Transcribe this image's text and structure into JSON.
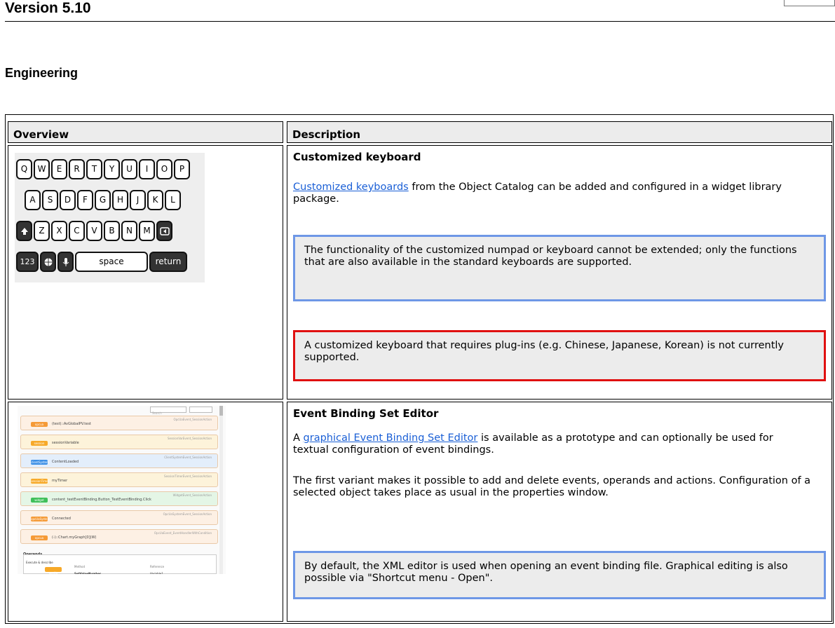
{
  "header": {
    "version_title": "Version 5.10",
    "section_heading": "Engineering"
  },
  "table": {
    "columns": [
      "Overview",
      "Description"
    ],
    "rows": [
      {
        "title": "Customized keyboard",
        "link_text": "Customized keyboards",
        "text_after_link": " from the Object Catalog can be added and configured in a widget library package.",
        "info_note": "The functionality of the customized numpad or keyboard cannot be extended; only the functions that are also available in the standard keyboards are supported.",
        "warning_note": "A customized keyboard that requires plug-ins (e.g. Chinese, Japanese, Korean) is not currently supported."
      },
      {
        "title": "Event Binding Set Editor",
        "text_before_link": "A ",
        "link_text": "graphical Event Binding Set Editor",
        "text_after_link": " is available as a prototype and can optionally be used for textual configuration of event bindings.",
        "paragraph2": "The first variant makes it possible to add and delete events, operands and actions. Configuration of a selected object takes place as usual in the properties window.",
        "info_note": "By default, the XML editor is used when opening an event binding file. Graphical editing is also possible via \"Shortcut menu - Open\"."
      }
    ]
  },
  "keyboard_image": {
    "row1": [
      "Q",
      "W",
      "E",
      "R",
      "T",
      "Y",
      "U",
      "I",
      "O",
      "P"
    ],
    "row2": [
      "A",
      "S",
      "D",
      "F",
      "G",
      "H",
      "J",
      "K",
      "L"
    ],
    "row3_keys": [
      "Z",
      "X",
      "C",
      "V",
      "B",
      "N",
      "M"
    ],
    "num_label": "123",
    "space_label": "space",
    "return_label": "return",
    "shift_icon": "shift-arrow-icon",
    "backspace_icon": "backspace-icon",
    "globe_icon": "globe-icon",
    "mic_icon": "microphone-icon"
  },
  "editor_image": {
    "rows": [
      {
        "tag": "opcua",
        "text": "(test)::AvGlobalPV.test",
        "meta": "OpcUaEvent_SessionAction",
        "tag_color": "#f59a36",
        "bg": "#fdf0e4"
      },
      {
        "tag": "session",
        "text": "sessionVariable",
        "meta": "SessionVarEvent_SessionAction",
        "tag_color": "#f7a928",
        "bg": "#fdf3da"
      },
      {
        "tag": "clientSystem",
        "text": "ContentLoaded",
        "meta": "ClientSystemEvent_SessionAction",
        "tag_color": "#3b8fe6",
        "bg": "#e3eefb"
      },
      {
        "tag": "sessionTimer",
        "text": "myTimer",
        "meta": "SessionTimerEvent_SessionAction",
        "tag_color": "#f7a928",
        "bg": "#fdf3da"
      },
      {
        "tag": "widget",
        "text": "content_testEventBinding.Button_TestEventBinding.Click",
        "meta": "WidgetEvent_SessionAction",
        "tag_color": "#3fbf5a",
        "bg": "#e4f6e6"
      },
      {
        "tag": "opcUaSystem",
        "text": "Connected",
        "meta": "OpcUaSystemEvent_SessionAction",
        "tag_color": "#f59a36",
        "bg": "#fdf0e4"
      },
      {
        "tag": "opcua",
        "text": "(-)::Chart.myGraph[0](W)",
        "meta": "OpcUaEvent_EventHandlerWithCondition",
        "tag_color": "#f59a36",
        "bg": "#fdf0e4"
      }
    ],
    "operands_label": "Operands",
    "execute_label": "Execute & describe",
    "method_col": "Method",
    "reference_col": "Reference",
    "last_tag": "opcUa",
    "last_method": "SetValueNumber",
    "last_ref": "Variable1",
    "search_placeholder": "Search"
  }
}
